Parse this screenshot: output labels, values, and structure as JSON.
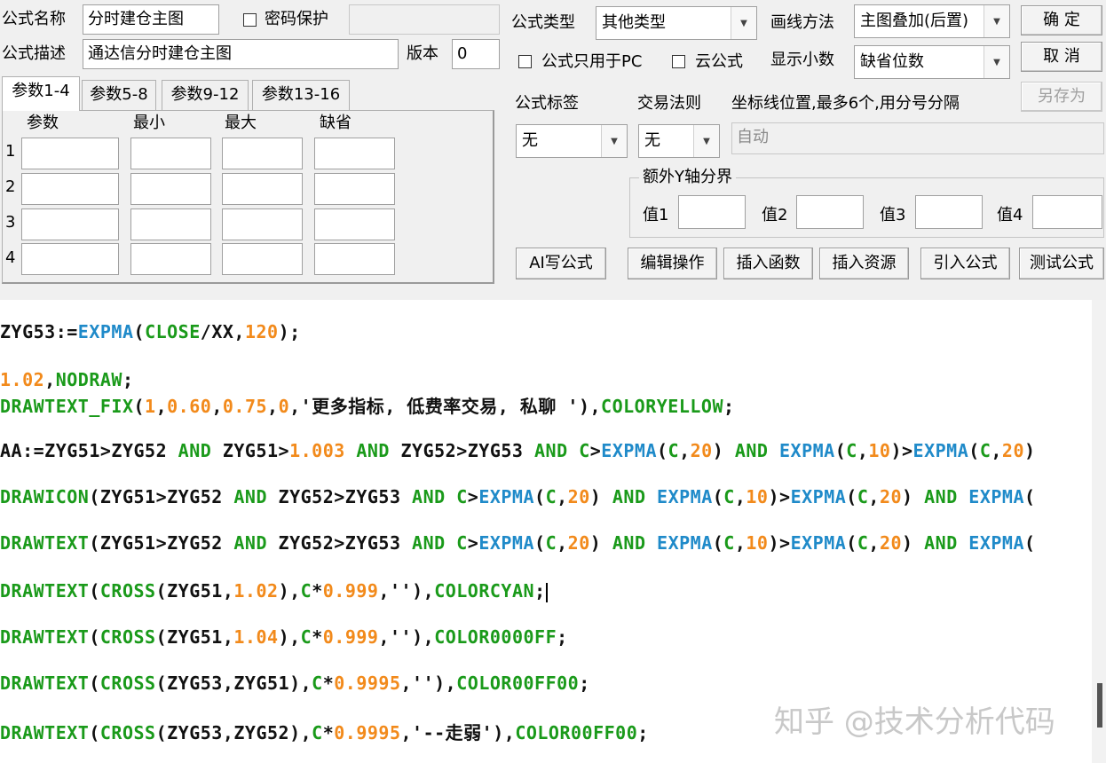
{
  "form": {
    "name_label": "公式名称",
    "name_value": "分时建仓主图",
    "password_label": "密码保护",
    "desc_label": "公式描述",
    "desc_value": "通达信分时建仓主图",
    "version_label": "版本",
    "version_value": "0",
    "type_label": "公式类型",
    "type_value": "其他类型",
    "draw_label": "画线方法",
    "draw_value": "主图叠加(后置)",
    "pc_only_label": "公式只用于PC",
    "cloud_label": "云公式",
    "decimals_label": "显示小数",
    "decimals_value": "缺省位数",
    "tag_label": "公式标签",
    "tag_value": "无",
    "rule_label": "交易法则",
    "rule_value": "无",
    "coord_label": "坐标线位置,最多6个,用分号分隔",
    "coord_placeholder": "自动",
    "y_axis_label": "额外Y轴分界",
    "v1": "值1",
    "v2": "值2",
    "v3": "值3",
    "v4": "值4"
  },
  "buttons": {
    "ok": "确 定",
    "cancel": "取 消",
    "save_as": "另存为",
    "ai": "AI写公式",
    "edit": "编辑操作",
    "insert_func": "插入函数",
    "insert_res": "插入资源",
    "import": "引入公式",
    "test": "测试公式"
  },
  "tabs": [
    "参数1-4",
    "参数5-8",
    "参数9-12",
    "参数13-16"
  ],
  "params": {
    "headers": [
      "参数",
      "最小",
      "最大",
      "缺省"
    ],
    "rows": [
      "1",
      "2",
      "3",
      "4"
    ]
  },
  "code_colors": {
    "keyword": "#111111",
    "green": "#1a9a1a",
    "blue": "#1f8ac9",
    "orange": "#f28a1b"
  },
  "code": [
    [
      [
        "k",
        "ZYG53:="
      ],
      [
        "b",
        "EXPMA"
      ],
      [
        "k",
        "("
      ],
      [
        "g",
        "CLOSE"
      ],
      [
        "k",
        "/XX,"
      ],
      [
        "o",
        "120"
      ],
      [
        "k",
        ");"
      ]
    ],
    [
      [
        "o",
        "1.02"
      ],
      [
        "k",
        ","
      ],
      [
        "g",
        "NODRAW"
      ],
      [
        "k",
        ";"
      ]
    ],
    [
      [
        "g",
        "DRAWTEXT_FIX"
      ],
      [
        "k",
        "("
      ],
      [
        "o",
        "1"
      ],
      [
        "k",
        ","
      ],
      [
        "o",
        "0.60"
      ],
      [
        "k",
        ","
      ],
      [
        "o",
        "0.75"
      ],
      [
        "k",
        ","
      ],
      [
        "o",
        "0"
      ],
      [
        "k",
        ",'更多指标, 低费率交易, 私聊 '),"
      ],
      [
        "g",
        "COLORYELLOW"
      ],
      [
        "k",
        ";"
      ]
    ],
    [
      [
        "k",
        "AA:=ZYG51>ZYG52 "
      ],
      [
        "g",
        "AND"
      ],
      [
        "k",
        " ZYG51>"
      ],
      [
        "o",
        "1.003"
      ],
      [
        "k",
        " "
      ],
      [
        "g",
        "AND"
      ],
      [
        "k",
        " ZYG52>ZYG53 "
      ],
      [
        "g",
        "AND"
      ],
      [
        "k",
        " "
      ],
      [
        "g",
        "C"
      ],
      [
        "k",
        ">"
      ],
      [
        "b",
        "EXPMA"
      ],
      [
        "k",
        "("
      ],
      [
        "g",
        "C"
      ],
      [
        "k",
        ","
      ],
      [
        "o",
        "20"
      ],
      [
        "k",
        ") "
      ],
      [
        "g",
        "AND"
      ],
      [
        "k",
        " "
      ],
      [
        "b",
        "EXPMA"
      ],
      [
        "k",
        "("
      ],
      [
        "g",
        "C"
      ],
      [
        "k",
        ","
      ],
      [
        "o",
        "10"
      ],
      [
        "k",
        ")>"
      ],
      [
        "b",
        "EXPMA"
      ],
      [
        "k",
        "("
      ],
      [
        "g",
        "C"
      ],
      [
        "k",
        ","
      ],
      [
        "o",
        "20"
      ],
      [
        "k",
        ")"
      ]
    ],
    [
      [
        "g",
        "DRAWICON"
      ],
      [
        "k",
        "(ZYG51>ZYG52 "
      ],
      [
        "g",
        "AND"
      ],
      [
        "k",
        " ZYG52>ZYG53 "
      ],
      [
        "g",
        "AND"
      ],
      [
        "k",
        " "
      ],
      [
        "g",
        "C"
      ],
      [
        "k",
        ">"
      ],
      [
        "b",
        "EXPMA"
      ],
      [
        "k",
        "("
      ],
      [
        "g",
        "C"
      ],
      [
        "k",
        ","
      ],
      [
        "o",
        "20"
      ],
      [
        "k",
        ") "
      ],
      [
        "g",
        "AND"
      ],
      [
        "k",
        " "
      ],
      [
        "b",
        "EXPMA"
      ],
      [
        "k",
        "("
      ],
      [
        "g",
        "C"
      ],
      [
        "k",
        ","
      ],
      [
        "o",
        "10"
      ],
      [
        "k",
        ")>"
      ],
      [
        "b",
        "EXPMA"
      ],
      [
        "k",
        "("
      ],
      [
        "g",
        "C"
      ],
      [
        "k",
        ","
      ],
      [
        "o",
        "20"
      ],
      [
        "k",
        ") "
      ],
      [
        "g",
        "AND"
      ],
      [
        "k",
        " "
      ],
      [
        "b",
        "EXPMA"
      ],
      [
        "k",
        "("
      ]
    ],
    [
      [
        "g",
        "DRAWTEXT"
      ],
      [
        "k",
        "(ZYG51>ZYG52 "
      ],
      [
        "g",
        "AND"
      ],
      [
        "k",
        " ZYG52>ZYG53 "
      ],
      [
        "g",
        "AND"
      ],
      [
        "k",
        " "
      ],
      [
        "g",
        "C"
      ],
      [
        "k",
        ">"
      ],
      [
        "b",
        "EXPMA"
      ],
      [
        "k",
        "("
      ],
      [
        "g",
        "C"
      ],
      [
        "k",
        ","
      ],
      [
        "o",
        "20"
      ],
      [
        "k",
        ") "
      ],
      [
        "g",
        "AND"
      ],
      [
        "k",
        " "
      ],
      [
        "b",
        "EXPMA"
      ],
      [
        "k",
        "("
      ],
      [
        "g",
        "C"
      ],
      [
        "k",
        ","
      ],
      [
        "o",
        "10"
      ],
      [
        "k",
        ")>"
      ],
      [
        "b",
        "EXPMA"
      ],
      [
        "k",
        "("
      ],
      [
        "g",
        "C"
      ],
      [
        "k",
        ","
      ],
      [
        "o",
        "20"
      ],
      [
        "k",
        ") "
      ],
      [
        "g",
        "AND"
      ],
      [
        "k",
        " "
      ],
      [
        "b",
        "EXPMA"
      ],
      [
        "k",
        "("
      ]
    ],
    [
      [
        "g",
        "DRAWTEXT"
      ],
      [
        "k",
        "("
      ],
      [
        "g",
        "CROSS"
      ],
      [
        "k",
        "(ZYG51,"
      ],
      [
        "o",
        "1.02"
      ],
      [
        "k",
        "),"
      ],
      [
        "g",
        "C"
      ],
      [
        "k",
        "*"
      ],
      [
        "o",
        "0.999"
      ],
      [
        "k",
        ",''),"
      ],
      [
        "g",
        "COLORCYAN"
      ],
      [
        "k",
        ";"
      ]
    ],
    [
      [
        "g",
        "DRAWTEXT"
      ],
      [
        "k",
        "("
      ],
      [
        "g",
        "CROSS"
      ],
      [
        "k",
        "(ZYG51,"
      ],
      [
        "o",
        "1.04"
      ],
      [
        "k",
        "),"
      ],
      [
        "g",
        "C"
      ],
      [
        "k",
        "*"
      ],
      [
        "o",
        "0.999"
      ],
      [
        "k",
        ",''),"
      ],
      [
        "g",
        "COLOR0000FF"
      ],
      [
        "k",
        ";"
      ]
    ],
    [
      [
        "g",
        "DRAWTEXT"
      ],
      [
        "k",
        "("
      ],
      [
        "g",
        "CROSS"
      ],
      [
        "k",
        "(ZYG53,ZYG51),"
      ],
      [
        "g",
        "C"
      ],
      [
        "k",
        "*"
      ],
      [
        "o",
        "0.9995"
      ],
      [
        "k",
        ",''),"
      ],
      [
        "g",
        "COLOR00FF00"
      ],
      [
        "k",
        ";"
      ]
    ],
    [
      [
        "g",
        "DRAWTEXT"
      ],
      [
        "k",
        "("
      ],
      [
        "g",
        "CROSS"
      ],
      [
        "k",
        "(ZYG53,ZYG52),"
      ],
      [
        "g",
        "C"
      ],
      [
        "k",
        "*"
      ],
      [
        "o",
        "0.9995"
      ],
      [
        "k",
        ",'--走弱'),"
      ],
      [
        "g",
        "COLOR00FF00"
      ],
      [
        "k",
        ";"
      ]
    ]
  ],
  "watermark": "知乎 @技术分析代码"
}
